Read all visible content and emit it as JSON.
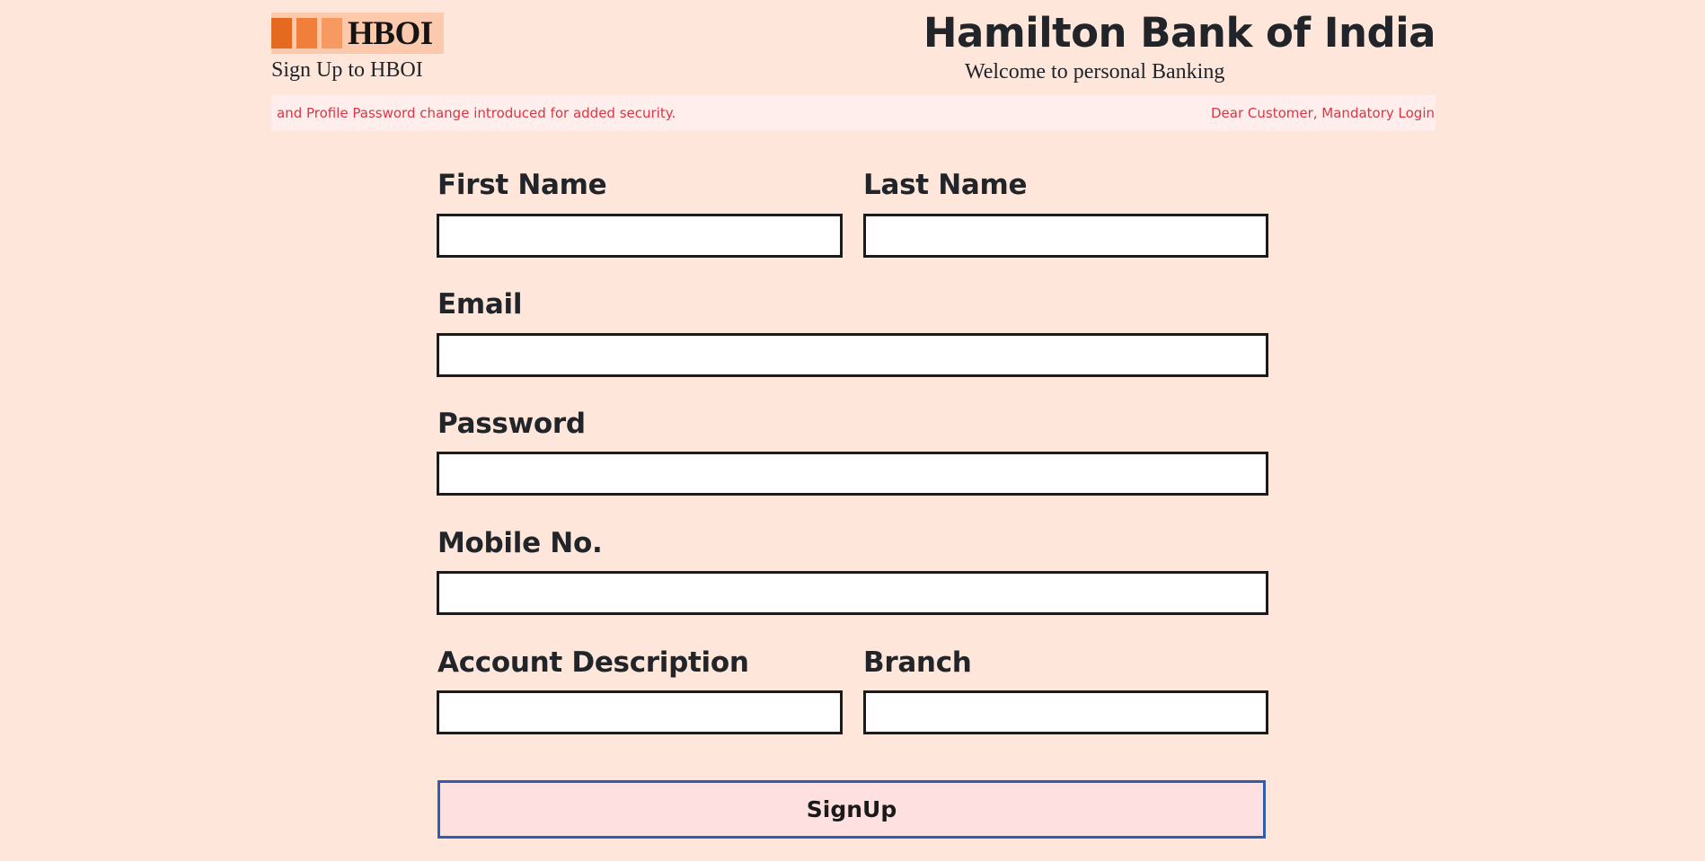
{
  "header": {
    "logo_text": "HBOI",
    "subtitle": "Sign Up to HBOI",
    "bank_title": "Hamilton Bank of India",
    "bank_subtitle": "Welcome to personal Banking"
  },
  "ticker": {
    "segment_a": "and Profile Password change introduced for added security.",
    "segment_b": "Dear Customer, Mandatory Login a"
  },
  "form": {
    "first_name_label": "First Name",
    "last_name_label": "Last Name",
    "email_label": "Email",
    "password_label": "Password",
    "mobile_label": "Mobile No.",
    "account_description_label": "Account Description",
    "branch_label": "Branch",
    "first_name_value": "",
    "last_name_value": "",
    "email_value": "",
    "password_value": "",
    "mobile_value": "",
    "account_description_value": "",
    "branch_value": "",
    "signup_label": "SignUp"
  },
  "colors": {
    "background": "#fee6da",
    "ticker_background": "#ffeeeb",
    "ticker_text": "#dc3545",
    "button_background": "#ffe0e1",
    "button_border": "#2f5db0",
    "logo_orange": "#e36a1f"
  }
}
